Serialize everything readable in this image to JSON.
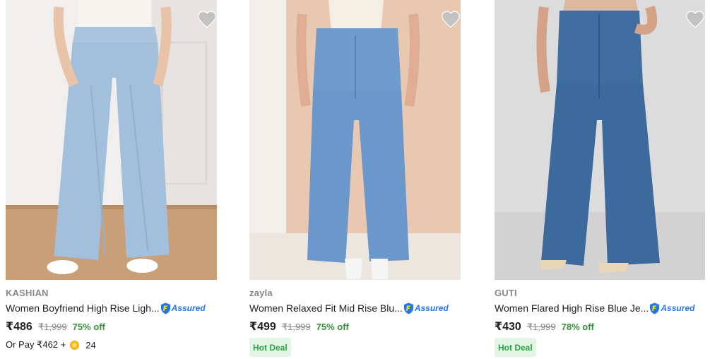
{
  "assured_label": "Assured",
  "colors": {
    "discount": "#388e3c",
    "assured_blue": "#2874f0",
    "hot_deal_text": "#26a541",
    "hot_deal_bg": "#e3f6e5",
    "wishlist_heart": "#c2c2c2"
  },
  "products": [
    {
      "brand": "KASHIAN",
      "title": "Women Boyfriend High Rise Ligh...",
      "price": "₹486",
      "mrp": "₹1,999",
      "discount": "75% off",
      "pay_prefix": "Or Pay ₹462 +",
      "coins": "24",
      "icons": {
        "wishlist": "heart-icon",
        "assured": "flipkart-assured-icon",
        "coin": "supercoin-icon"
      }
    },
    {
      "brand": "zayla",
      "title": "Women Relaxed Fit Mid Rise Blu...",
      "price": "₹499",
      "mrp": "₹1,999",
      "discount": "75% off",
      "badge": "Hot Deal",
      "icons": {
        "wishlist": "heart-icon",
        "assured": "flipkart-assured-icon"
      }
    },
    {
      "brand": "GUTI",
      "title": "Women Flared High Rise Blue Je...",
      "price": "₹430",
      "mrp": "₹1,999",
      "discount": "78% off",
      "badge": "Hot Deal",
      "icons": {
        "wishlist": "heart-icon",
        "assured": "flipkart-assured-icon"
      }
    }
  ]
}
